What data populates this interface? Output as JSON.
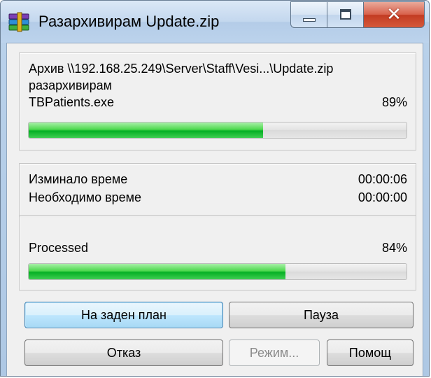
{
  "window": {
    "title": "Разархивирам Update.zip"
  },
  "file_group": {
    "archive_path": "Архив \\\\192.168.25.249\\Server\\Staff\\Vesi...\\Update.zip",
    "action": "разархивирам",
    "current_file": "TBPatients.exe",
    "file_percent_text": "89%",
    "file_progress": 0.62
  },
  "time_group": {
    "elapsed_label": "Изминало време",
    "elapsed_value": "00:00:06",
    "remaining_label": "Необходимо време",
    "remaining_value": "00:00:00",
    "processed_label": "Processed",
    "processed_percent_text": "84%",
    "processed_progress": 0.68
  },
  "buttons": {
    "background": "На заден план",
    "pause": "Пауза",
    "cancel": "Отказ",
    "mode": "Режим...",
    "help": "Помощ"
  },
  "icons": {
    "app": "winrar-books-icon",
    "minimize": "minimize-icon",
    "maximize": "maximize-icon",
    "close": "close-icon"
  },
  "colors": {
    "progress_green": "#06b025",
    "default_button_border": "#3c7fb1",
    "close_button_red": "#c23b22"
  }
}
